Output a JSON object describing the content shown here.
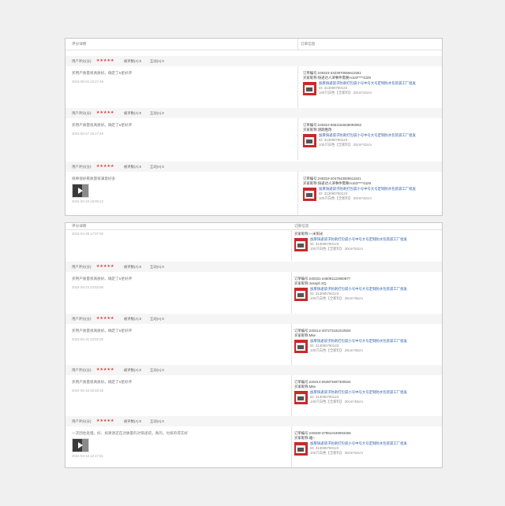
{
  "labels": {
    "comment_col": "评分详情",
    "order_col": "订单信息",
    "score_label": "用户评分(分):",
    "useful_label": "能力数:0",
    "useless_label": "反对:0",
    "order_no_label": "订单编号:",
    "buyer_label": "买家昵称:",
    "stars": "★★★★★"
  },
  "panel1": {
    "reviews": [
      {
        "useful": "被评数(A):0",
        "useless": "互动(A):0",
        "comment": "买用户质量很真质好。确定了5星好评",
        "date": "2024-09-04 16:27:49",
        "has_image": false,
        "order_no": "订单编号:248323-3423970556611551",
        "buyer": "买家昵称:快递达人津事件需要m103****4329",
        "product_name": "加厚快递袋子防刺打包袋小号中号大号定制防水包装袋工厂批发",
        "product_id": "ID: 313090790123",
        "product_spec": "100只白色【全新料】 20cm*42cm"
      },
      {
        "useful": "被评数(A):0",
        "useless": "互动(A):0",
        "comment": "买用户质量很真质好。确定了5星好评",
        "date": "2024-03-27 16:17:49",
        "has_image": false,
        "order_no": "订单编号:249310-5654184648093063",
        "buyer": "买家昵称:请期胜改",
        "product_name": "加厚快递袋子防刺打包袋小号中号大号定制防水包装袋工厂批发",
        "product_id": "ID: 313090790123",
        "product_spec": "100只白色【全新料】 20cm*42cm"
      },
      {
        "useful": "被评数(A):0",
        "useless": "互动(A):0",
        "comment": "很棒很好看质量很满意好多",
        "date": "2024-03-23 16:09:12",
        "has_image": true,
        "order_no": "订单编号:248319-2047543006611521",
        "buyer": "买家昵称:快递达人津事件需要m163****4329",
        "product_name": "加厚快递袋子防刺打包袋小号中号大号定制防水包装袋工厂批发",
        "product_id": "ID: 313090790123",
        "product_spec": "100只白色【全新料】 20cm*42cm"
      }
    ]
  },
  "panel2": {
    "partial_date": "2024-04-28 17:07:02",
    "partial_buyer": "买家昵称:一米阳光",
    "partial_product_name": "加厚快递袋子防刺打包袋小号中号大号定制防水包装袋工厂批发",
    "partial_product_id": "ID: 313090790123",
    "partial_product_spec": "100只白色【全新料】 30cm*52cm",
    "reviews": [
      {
        "useful": "被评数(A):0",
        "useless": "互动(A):0",
        "comment": "买用户质量很真质好。确定了5星好评",
        "date": "2024-04-23 23:53:58",
        "has_image": false,
        "order_no": "订单编号:240331-245091122850877",
        "buyer": "买家昵称:Joseph SQ",
        "product_name": "加厚快递袋子防刺打包袋小号中号大号定制防水包装袋工厂批发",
        "product_id": "ID: 313090790123",
        "product_spec": "100只白色【全新料】 25cm*35cm"
      },
      {
        "useful": "被评数(A):0",
        "useless": "互动(A):0",
        "comment": "买用户质量很真质好。确定了5星好评",
        "date": "2024-04-21 23:02:26",
        "has_image": false,
        "order_no": "订单编号:240414-407272181010504",
        "buyer": "买家昵称:Mke",
        "product_name": "加厚快递袋子防刺打包袋小号中号大号定制防水包装袋工厂批发",
        "product_id": "ID: 313090790123",
        "product_spec": "100只白色【全新料】 25cm*35cm"
      },
      {
        "useful": "被评数(A):0",
        "useless": "互动(A):0",
        "comment": "买用户质量很真质好。确定了5星好评",
        "date": "2024-04-16 20:33:16",
        "has_image": false,
        "order_no": "订单编号:240414-063974697300534",
        "buyer": "买家昵称:Mke",
        "product_name": "加厚快递袋子防刺打包袋小号中号大号定制防水包装袋工厂批发",
        "product_id": "ID: 313090790123",
        "product_spec": "100只白色【全新料】 30cm*45cm"
      },
      {
        "useful": "被评数(A):0",
        "useless": "互动(A):0",
        "comment": "一次因住处慢。好，如果请还在对质量的对快递袋，真的，也很的得实好",
        "date": "2024-04-10 12:17:51",
        "has_image": true,
        "order_no": "订单编号:240400-379510449093456",
        "buyer": "买家昵称:雅~",
        "product_name": "加厚快递袋子防刺打包袋小号中号大号定制防水包装袋工厂批发",
        "product_id": "ID: 313090790123",
        "product_spec": "100只白色【全新料】 30cm*52cm"
      }
    ]
  }
}
